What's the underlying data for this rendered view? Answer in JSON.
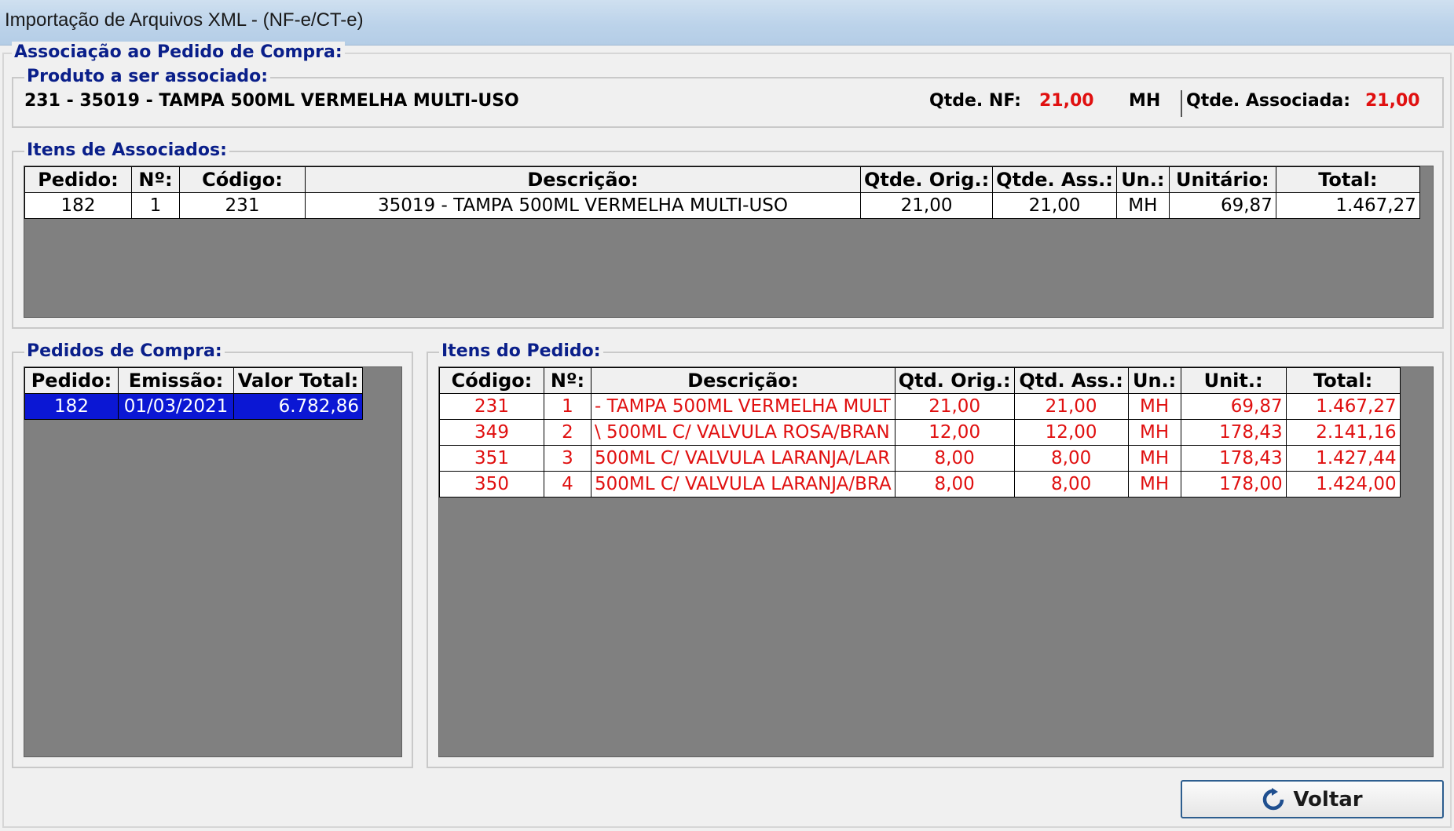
{
  "window": {
    "title": "Importação de Arquivos XML - (NF-e/CT-e)"
  },
  "group_main": {
    "legend": "Associação ao Pedido de Compra:"
  },
  "produto": {
    "legend": "Produto a ser associado:",
    "descricao": "231 - 35019 - TAMPA 500ML VERMELHA MULTI-USO",
    "qtde_nf_label": "Qtde. NF:",
    "qtde_nf_value": "21,00",
    "unidade": "MH",
    "qtde_associada_label": "Qtde. Associada:",
    "qtde_associada_value": "21,00"
  },
  "itens_associados": {
    "legend": "Itens de Associados:",
    "headers": [
      "Pedido:",
      "Nº:",
      "Código:",
      "Descrição:",
      "Qtde. Orig.:",
      "Qtde. Ass.:",
      "Un.:",
      "Unitário:",
      "Total:"
    ],
    "rows": [
      [
        "182",
        "1",
        "231",
        "35019 - TAMPA 500ML VERMELHA MULTI-USO",
        "21,00",
        "21,00",
        "MH",
        "69,87",
        "1.467,27"
      ]
    ]
  },
  "pedidos_compra": {
    "legend": "Pedidos de Compra:",
    "headers": [
      "Pedido:",
      "Emissão:",
      "Valor Total:"
    ],
    "rows": [
      [
        "182",
        "01/03/2021",
        "6.782,86"
      ]
    ]
  },
  "itens_pedido": {
    "legend": "Itens do Pedido:",
    "headers": [
      "Código:",
      "Nº:",
      "Descrição:",
      "Qtd. Orig.:",
      "Qtd. Ass.:",
      "Un.:",
      "Unit.:",
      "Total:"
    ],
    "rows": [
      [
        "231",
        "1",
        "- TAMPA 500ML VERMELHA MULT",
        "21,00",
        "21,00",
        "MH",
        "69,87",
        "1.467,27"
      ],
      [
        "349",
        "2",
        "\\ 500ML C/ VALVULA ROSA/BRAN",
        "12,00",
        "12,00",
        "MH",
        "178,43",
        "2.141,16"
      ],
      [
        "351",
        "3",
        "500ML C/ VALVULA LARANJA/LAR",
        "8,00",
        "8,00",
        "MH",
        "178,43",
        "1.427,44"
      ],
      [
        "350",
        "4",
        "500ML C/ VALVULA LARANJA/BRA",
        "8,00",
        "8,00",
        "MH",
        "178,00",
        "1.424,00"
      ]
    ]
  },
  "buttons": {
    "voltar": "Voltar",
    "voltar_icon": "refresh-back-icon"
  },
  "colors": {
    "legend": "#0a1f8a",
    "highlight_value": "#e01010",
    "selection": "#0b17d4",
    "grid_background": "#808080"
  }
}
